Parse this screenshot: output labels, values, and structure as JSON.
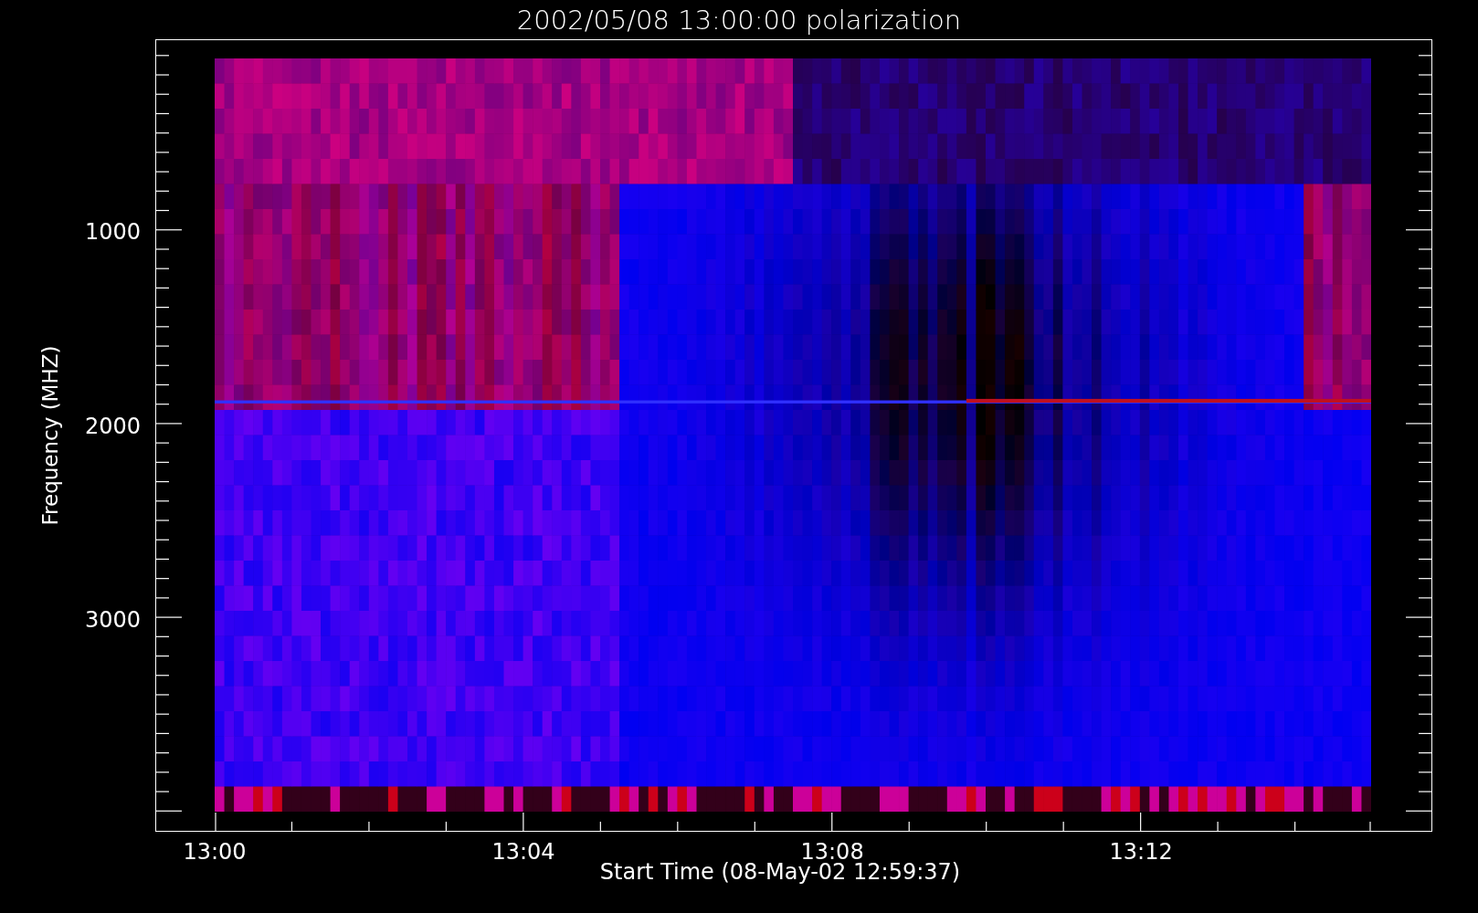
{
  "plot": {
    "title": "2002/05/08 13:00:00 polarization",
    "ylabel": "Frequency (MHZ)",
    "xlabel": "Start Time (08-May-02 12:59:37)",
    "yticks": [
      "1000",
      "2000",
      "3000"
    ],
    "xticks": [
      "13:00",
      "13:04",
      "13:08",
      "13:12"
    ]
  }
}
